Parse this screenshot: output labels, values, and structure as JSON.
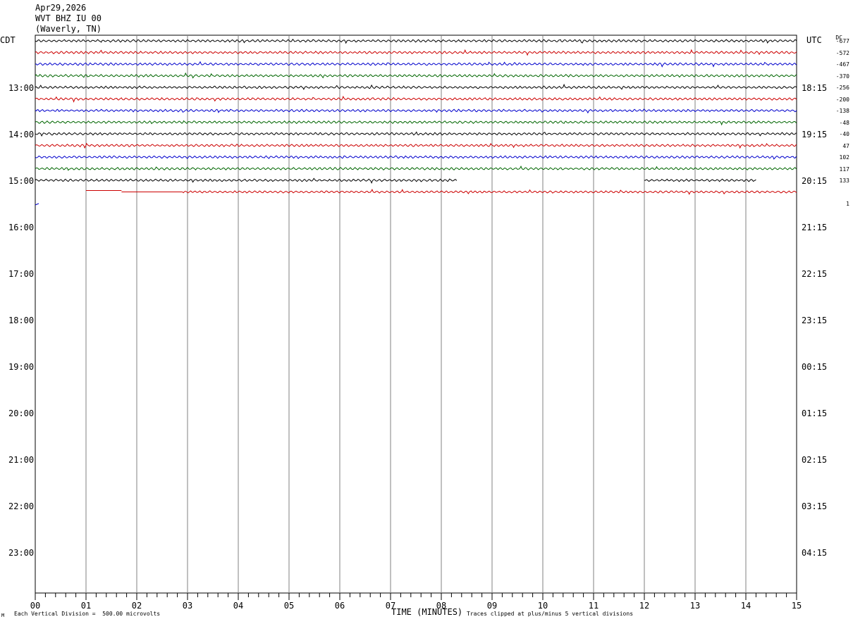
{
  "header": {
    "date": "Apr29,2026",
    "station": "WVT BHZ IU 00",
    "location": "(Waverly, TN)"
  },
  "left_tz": "CDT",
  "right_tz": "UTC",
  "dc_label": "DC",
  "footer": {
    "vertical_division": "Each Vertical Division =  500.00 microvolts",
    "clip_note": "Traces clipped at plus/minus 5 vertical divisions",
    "corner_mark": "M"
  },
  "chart_data": {
    "type": "line",
    "title": "WVT BHZ IU 00",
    "xlabel": "TIME (MINUTES)",
    "xlim": [
      0,
      15
    ],
    "x_ticks": [
      "00",
      "01",
      "02",
      "03",
      "04",
      "05",
      "06",
      "07",
      "08",
      "09",
      "10",
      "11",
      "12",
      "13",
      "14",
      "15"
    ],
    "left_hour_labels": [
      "13:00",
      "14:00",
      "15:00",
      "16:00",
      "17:00",
      "18:00",
      "19:00",
      "20:00",
      "21:00",
      "22:00",
      "23:00"
    ],
    "right_hour_labels": [
      "18:15",
      "19:15",
      "20:15",
      "21:15",
      "22:15",
      "23:15",
      "00:15",
      "01:15",
      "02:15",
      "03:15",
      "04:15"
    ],
    "colors": {
      "black": "#000000",
      "red": "#cc0000",
      "blue": "#0000cc",
      "green": "#006600",
      "grid": "#808080"
    },
    "traces": [
      {
        "row": 0,
        "color": "black",
        "dc_offset": "-677",
        "start_min": 0,
        "end_min": 15
      },
      {
        "row": 1,
        "color": "red",
        "dc_offset": "-572",
        "start_min": 0,
        "end_min": 15
      },
      {
        "row": 2,
        "color": "blue",
        "dc_offset": "-467",
        "start_min": 0,
        "end_min": 15
      },
      {
        "row": 3,
        "color": "green",
        "dc_offset": "-370",
        "start_min": 0,
        "end_min": 15
      },
      {
        "row": 4,
        "color": "black",
        "dc_offset": "-256",
        "start_min": 0,
        "end_min": 15
      },
      {
        "row": 5,
        "color": "red",
        "dc_offset": "-200",
        "start_min": 0,
        "end_min": 15
      },
      {
        "row": 6,
        "color": "blue",
        "dc_offset": "-138",
        "start_min": 0,
        "end_min": 15
      },
      {
        "row": 7,
        "color": "green",
        "dc_offset": "-48",
        "start_min": 0,
        "end_min": 15
      },
      {
        "row": 8,
        "color": "black",
        "dc_offset": "-40",
        "start_min": 0,
        "end_min": 15
      },
      {
        "row": 9,
        "color": "red",
        "dc_offset": "47",
        "start_min": 0,
        "end_min": 15
      },
      {
        "row": 10,
        "color": "blue",
        "dc_offset": "102",
        "start_min": 0,
        "end_min": 15
      },
      {
        "row": 11,
        "color": "green",
        "dc_offset": "117",
        "start_min": 0,
        "end_min": 15
      },
      {
        "row": 12,
        "color": "black",
        "dc_offset": "133",
        "start_min": 0,
        "end_min": 8.3,
        "resume_min": 12.0,
        "resume_end_min": 14.2
      },
      {
        "row": 13,
        "color": "red",
        "dc_offset": "",
        "start_min": 1.0,
        "end_min": 15
      },
      {
        "row": 14,
        "color": "blue",
        "dc_offset": "1",
        "start_min": 0,
        "end_min": 0.05
      }
    ]
  }
}
